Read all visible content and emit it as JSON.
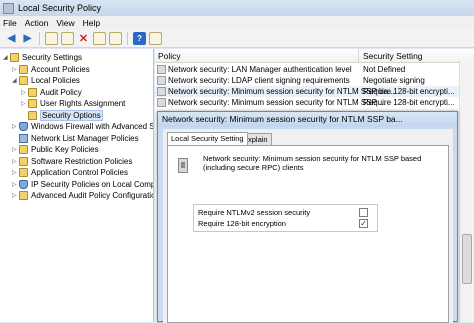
{
  "window": {
    "title": "Local Security Policy"
  },
  "menu": [
    "File",
    "Action",
    "View",
    "Help"
  ],
  "toolbar": {
    "icons": [
      "back-arrow-icon",
      "forward-arrow-icon",
      "up-folder-icon",
      "show-tree-icon",
      "delete-icon",
      "properties-icon",
      "export-list-icon",
      "help-icon",
      "console-icon"
    ]
  },
  "tree": {
    "items": [
      {
        "label": "Security Settings",
        "level": 0,
        "expander": "◢",
        "icon": "folder"
      },
      {
        "label": "Account Policies",
        "level": 1,
        "expander": "▷",
        "icon": "folder"
      },
      {
        "label": "Local Policies",
        "level": 1,
        "expander": "◢",
        "icon": "folder"
      },
      {
        "label": "Audit Policy",
        "level": 2,
        "expander": "▷",
        "icon": "folder"
      },
      {
        "label": "User Rights Assignment",
        "level": 2,
        "expander": "▷",
        "icon": "folder"
      },
      {
        "label": "Security Options",
        "level": 2,
        "expander": "",
        "icon": "folder",
        "selected": true
      },
      {
        "label": "Windows Firewall with Advanced Sec",
        "level": 1,
        "expander": "▷",
        "icon": "shield"
      },
      {
        "label": "Network List Manager Policies",
        "level": 1,
        "expander": "",
        "icon": "blue"
      },
      {
        "label": "Public Key Policies",
        "level": 1,
        "expander": "▷",
        "icon": "folder"
      },
      {
        "label": "Software Restriction Policies",
        "level": 1,
        "expander": "▷",
        "icon": "folder"
      },
      {
        "label": "Application Control Policies",
        "level": 1,
        "expander": "▷",
        "icon": "folder"
      },
      {
        "label": "IP Security Policies on Local Compute",
        "level": 1,
        "expander": "▷",
        "icon": "shield"
      },
      {
        "label": "Advanced Audit Policy Configuration",
        "level": 1,
        "expander": "▷",
        "icon": "folder"
      }
    ]
  },
  "list": {
    "columns": [
      "Policy",
      "Security Setting"
    ],
    "rows": [
      {
        "policy": "Network security: LAN Manager authentication level",
        "setting": "Not Defined"
      },
      {
        "policy": "Network security: LDAP client signing requirements",
        "setting": "Negotiate signing"
      },
      {
        "policy": "Network security: Minimum session security for NTLM SSP ba...",
        "setting": "Require 128-bit encrypti..."
      },
      {
        "policy": "Network security: Minimum session security for NTLM SSP ...",
        "setting": "Require 128-bit encrypti..."
      }
    ]
  },
  "dialog": {
    "title": "Network security: Minimum session security for NTLM SSP ba...",
    "tabs": [
      "Local Security Setting",
      "Explain"
    ],
    "description": "Network security: Minimum session security for NTLM SSP based (including secure RPC) clients",
    "options": [
      {
        "label": "Require NTLMv2 session security",
        "checked": false
      },
      {
        "label": "Require 128-bit encryption",
        "checked": true
      }
    ]
  }
}
